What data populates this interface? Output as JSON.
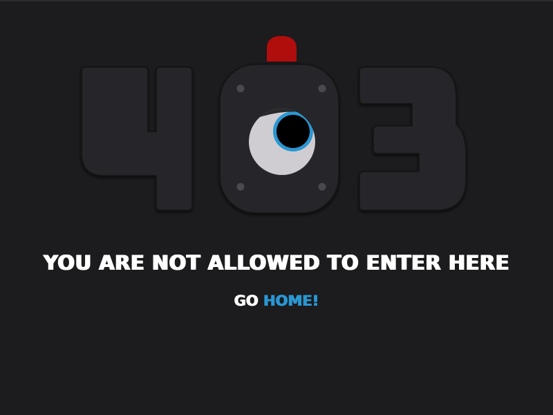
{
  "error_code": "403",
  "message": "YOU ARE NOT ALLOWED TO ENTER HERE",
  "go_home": {
    "prefix": "GO",
    "link_label": "HOME!"
  },
  "icons": {
    "siren": "red-siren-icon",
    "eye": "eye-icon",
    "digit_4": "digit-four-shape",
    "digit_0_door": "digit-zero-vault-door",
    "digit_3": "digit-three-shape"
  },
  "colors": {
    "background": "#1c1b1d",
    "digit_fill": "#28272a",
    "siren": "#b00d0d",
    "eye_white": "#cfcdd1",
    "iris": "#2a97d3",
    "pupil": "#000000",
    "text": "#ffffff",
    "link": "#2a97d3"
  }
}
